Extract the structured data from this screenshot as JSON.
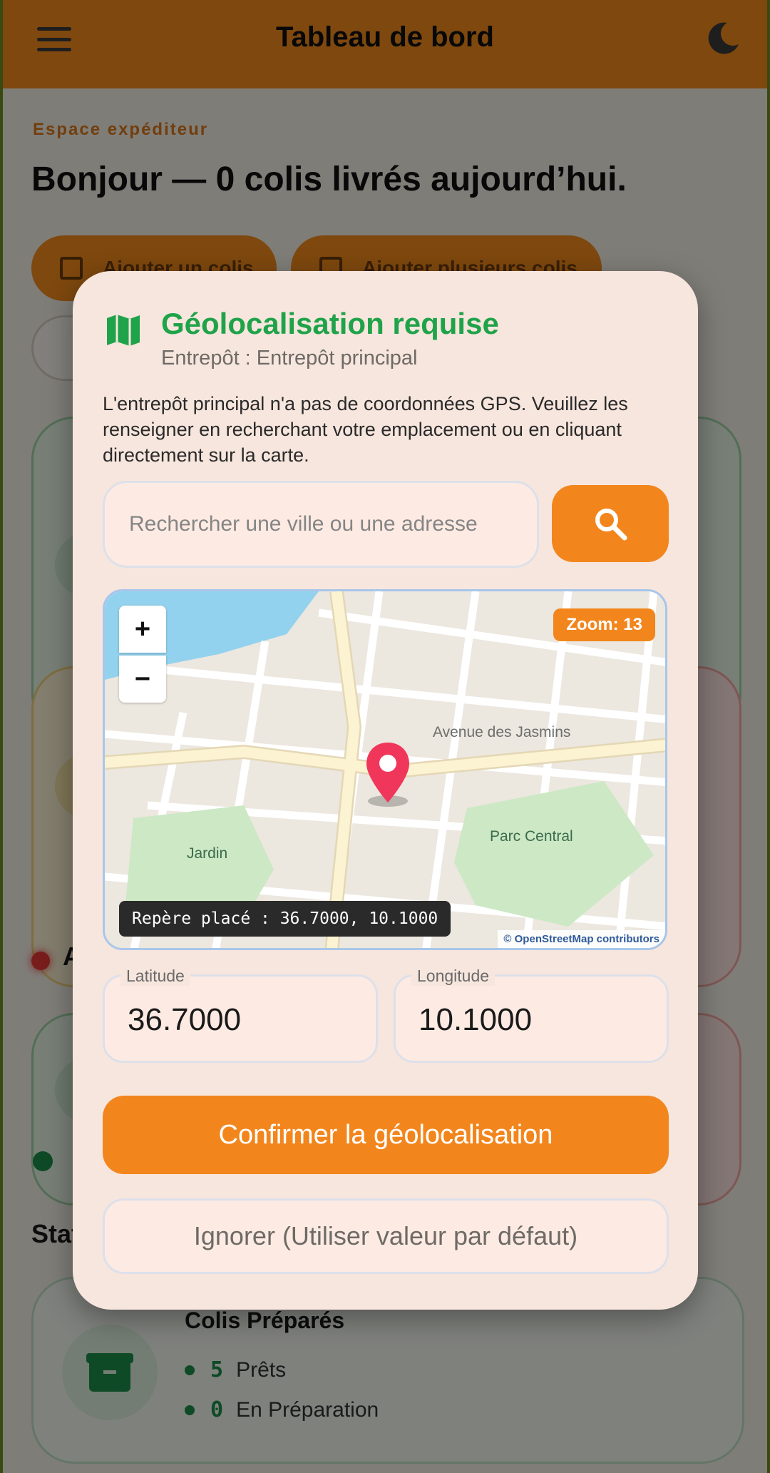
{
  "header": {
    "title": "Tableau de bord",
    "menu_icon": "hamburger-menu-icon",
    "theme_icon": "moon-icon"
  },
  "dashboard": {
    "kicker": "Espace expéditeur",
    "greeting": "Bonjour — 0 colis livrés aujourd’hui.",
    "add_parcel_label": "Ajouter un colis",
    "add_multiple_label": "Ajouter plusieurs colis",
    "section_letter": "A",
    "stats_heading_partial": "Stat",
    "prepared_card": {
      "title": "Colis Préparés",
      "rows": [
        {
          "count": "5",
          "label": "Prêts"
        },
        {
          "count": "0",
          "label": "En Préparation"
        }
      ]
    }
  },
  "modal": {
    "title": "Géolocalisation requise",
    "subtitle": "Entrepôt : Entrepôt principal",
    "description": "L'entrepôt principal n'a pas de coordonnées GPS. Veuillez les renseigner en recherchant votre emplacement ou en cliquant directement sur la carte.",
    "search_placeholder": "Rechercher une ville ou une adresse",
    "search_value": "",
    "map": {
      "zoom_in": "+",
      "zoom_out": "−",
      "zoom_badge": "Zoom: 13",
      "street_label": "Avenue des Jasmins",
      "park_label_1": "Jardin",
      "park_label_2": "Parc Central",
      "placed_text": "Repère placé : 36.7000, 10.1000",
      "attribution": "© OpenStreetMap contributors"
    },
    "latitude_label": "Latitude",
    "latitude_value": "36.7000",
    "longitude_label": "Longitude",
    "longitude_value": "10.1000",
    "confirm_label": "Confirmer la géolocalisation",
    "ignore_label": "Ignorer (Utiliser valeur par défaut)"
  },
  "colors": {
    "accent": "#f2861d",
    "title_green": "#1fa34a",
    "modal_bg": "#f7e6dd",
    "marker": "#f0365a"
  }
}
